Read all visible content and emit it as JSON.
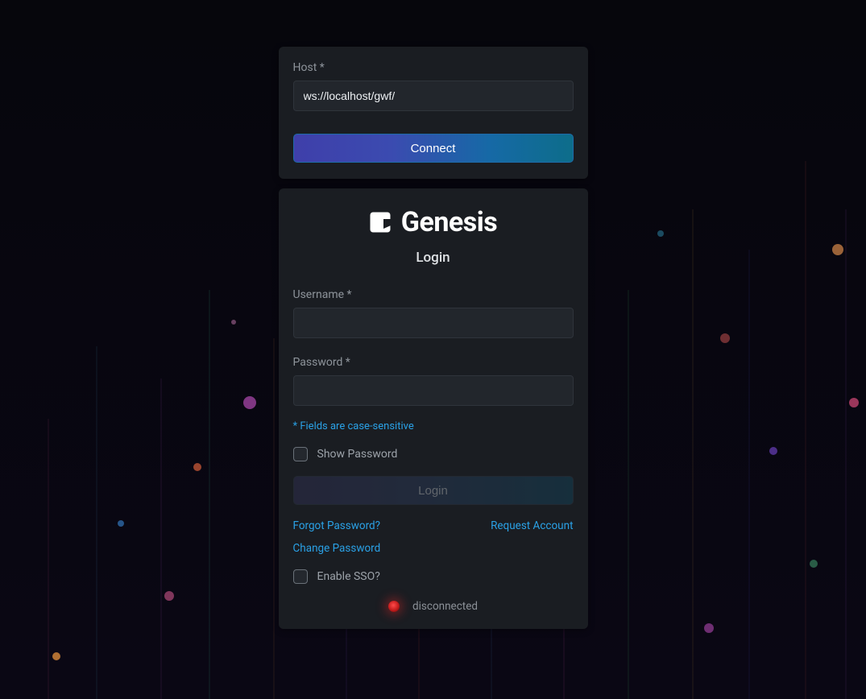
{
  "brand": {
    "name": "Genesis"
  },
  "connect": {
    "host_label": "Host *",
    "host_value": "ws://localhost/gwf/",
    "connect_label": "Connect"
  },
  "login": {
    "title": "Login",
    "username_label": "Username *",
    "username_value": "",
    "password_label": "Password *",
    "password_value": "",
    "case_note": "* Fields are case-sensitive",
    "show_password_label": "Show Password",
    "login_button": "Login",
    "forgot_password": "Forgot Password?",
    "request_account": "Request Account",
    "change_password": "Change Password",
    "enable_sso_label": "Enable SSO?"
  },
  "status": {
    "text": "disconnected",
    "color": "#ff3b30"
  },
  "colors": {
    "panel_bg": "#1a1d22",
    "input_bg": "#22262c",
    "accent_blue": "#2aa1e6"
  }
}
